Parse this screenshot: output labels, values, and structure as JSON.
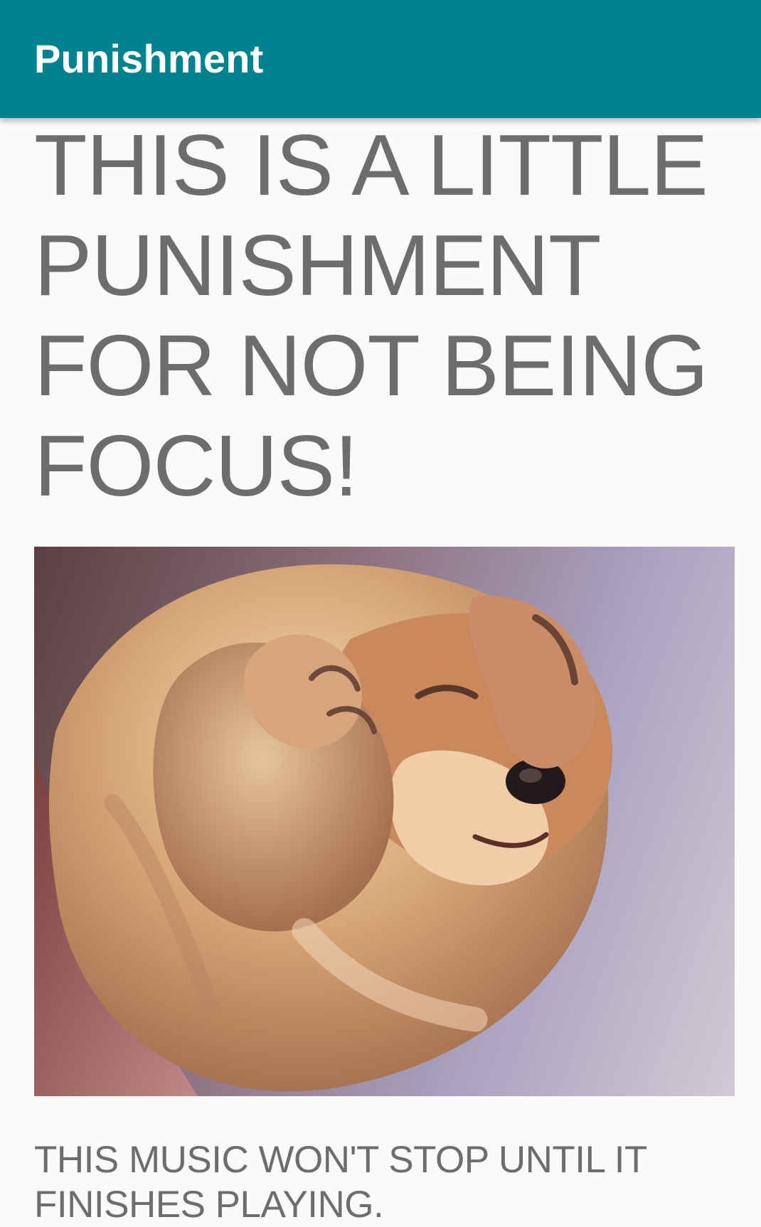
{
  "app_bar": {
    "title": "Punishment",
    "background_color": "#00838f"
  },
  "content": {
    "headline": "THIS IS A LITTLE PUNISHMENT FOR NOT BEING FOCUS!",
    "image_icon": "puppy-covering-face-photo",
    "message": "THIS MUSIC WON'T STOP UNTIL IT FINISHES PLAYING."
  },
  "colors": {
    "text_gray": "#6d6d6d",
    "page_background": "#fafafa"
  }
}
